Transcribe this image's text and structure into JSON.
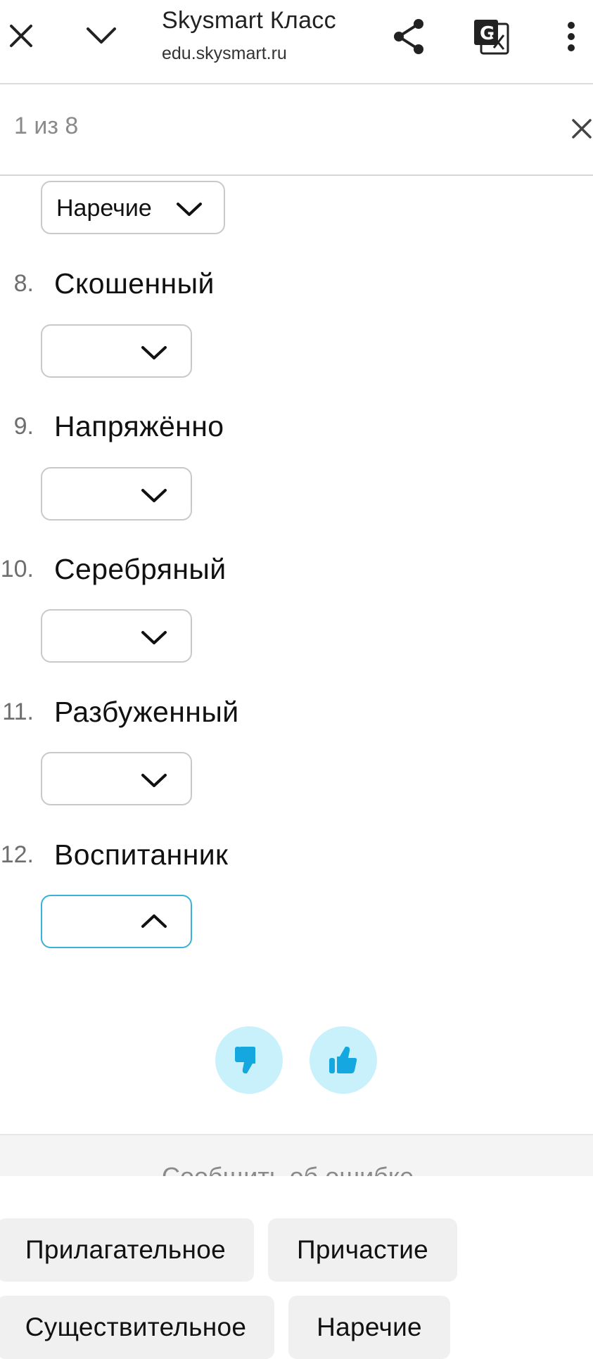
{
  "browser": {
    "title": "Skysmart Класс",
    "url": "edu.skysmart.ru",
    "icons": [
      "close-icon",
      "chevron-down-icon",
      "share-icon",
      "translate-icon",
      "more-vert-icon"
    ]
  },
  "find": {
    "count": "1 из 8"
  },
  "items": [
    {
      "selected": "Наречие"
    },
    {
      "number": "8.",
      "word": "Скошенный",
      "selected": ""
    },
    {
      "number": "9.",
      "word": "Напряжённо",
      "selected": ""
    },
    {
      "number": "10.",
      "word": "Серебряный",
      "selected": ""
    },
    {
      "number": "11.",
      "word": "Разбуженный",
      "selected": ""
    },
    {
      "number": "12.",
      "word": "Воспитанник",
      "selected": ""
    }
  ],
  "feedback": {
    "report_label": "Сообщить об ошибке",
    "accent": "#15a7e0",
    "bg": "#c9f1fb"
  },
  "options": [
    "Прилагательное",
    "Причастие",
    "Существительное",
    "Наречие"
  ]
}
